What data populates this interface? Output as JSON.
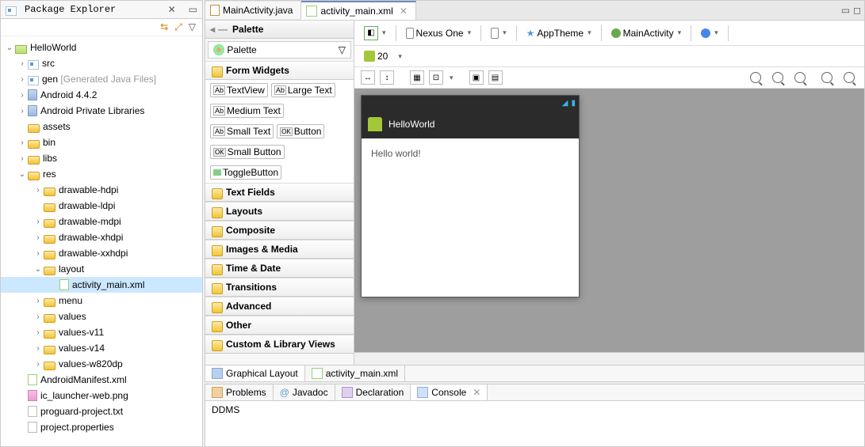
{
  "explorer": {
    "title": "Package Explorer",
    "project": "HelloWorld",
    "nodes": {
      "src": "src",
      "gen": "gen",
      "genSuffix": "[Generated Java Files]",
      "android": "Android 4.4.2",
      "privLibs": "Android Private Libraries",
      "assets": "assets",
      "bin": "bin",
      "libs": "libs",
      "res": "res",
      "hdpi": "drawable-hdpi",
      "ldpi": "drawable-ldpi",
      "mdpi": "drawable-mdpi",
      "xhdpi": "drawable-xhdpi",
      "xxhdpi": "drawable-xxhdpi",
      "layout": "layout",
      "actMain": "activity_main.xml",
      "menu": "menu",
      "values": "values",
      "v11": "values-v11",
      "v14": "values-v14",
      "w820": "values-w820dp",
      "manifest": "AndroidManifest.xml",
      "launcher": "ic_launcher-web.png",
      "proguard": "proguard-project.txt",
      "projprop": "project.properties"
    }
  },
  "editorTabs": {
    "main": "MainActivity.java",
    "layout": "activity_main.xml"
  },
  "palette": {
    "title": "Palette",
    "selector": "Palette",
    "formWidgets": "Form Widgets",
    "widgets": {
      "textview": "TextView",
      "largetext": "Large Text",
      "medtext": "Medium Text",
      "smalltext": "Small Text",
      "button": "Button",
      "smallbtn": "Small Button",
      "toggle": "ToggleButton"
    },
    "cats": {
      "textfields": "Text Fields",
      "layouts": "Layouts",
      "composite": "Composite",
      "images": "Images & Media",
      "timedate": "Time & Date",
      "transitions": "Transitions",
      "advanced": "Advanced",
      "other": "Other",
      "custom": "Custom & Library Views"
    }
  },
  "toolbar": {
    "device": "Nexus One",
    "theme": "AppTheme",
    "activity": "MainActivity",
    "api": "20"
  },
  "preview": {
    "appName": "HelloWorld",
    "content": "Hello world!"
  },
  "bottomTabs": {
    "graphical": "Graphical Layout",
    "xml": "activity_main.xml"
  },
  "console": {
    "problems": "Problems",
    "javadoc": "Javadoc",
    "decl": "Declaration",
    "cons": "Console",
    "output": "DDMS"
  }
}
